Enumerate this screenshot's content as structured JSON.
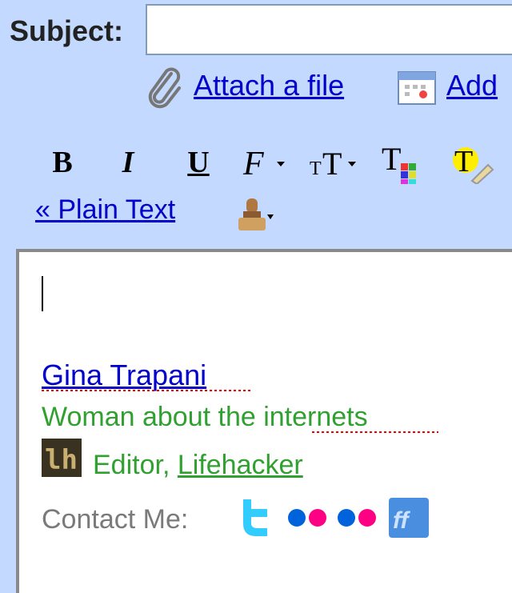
{
  "compose": {
    "subject_label": "Subject:",
    "subject_value": "",
    "attach_label": "Attach a file",
    "add_label": "Add"
  },
  "toolbar": {
    "bold": "B",
    "italic": "I",
    "underline": "U",
    "plain_text": "« Plain Text",
    "icons": [
      "paperclip-icon",
      "calendar-icon",
      "font-icon",
      "text-size-icon",
      "text-color-icon",
      "highlight-color-icon",
      "stamp-icon"
    ]
  },
  "signature": {
    "name": "Gina Trapani",
    "tagline": "Woman about the internets",
    "title_prefix": "Editor, ",
    "company": "Lifehacker",
    "contact_label": "Contact Me:",
    "logo_text": "lh"
  },
  "colors": {
    "background": "#c3d9ff",
    "link": "#0000cc",
    "signature_green": "#30a030",
    "contact_gray": "#7a7a7a",
    "twitter": "#33ccff",
    "flickr_blue": "#0063dc",
    "flickr_pink": "#ff0084",
    "friendfeed": "#4a8ee0"
  }
}
